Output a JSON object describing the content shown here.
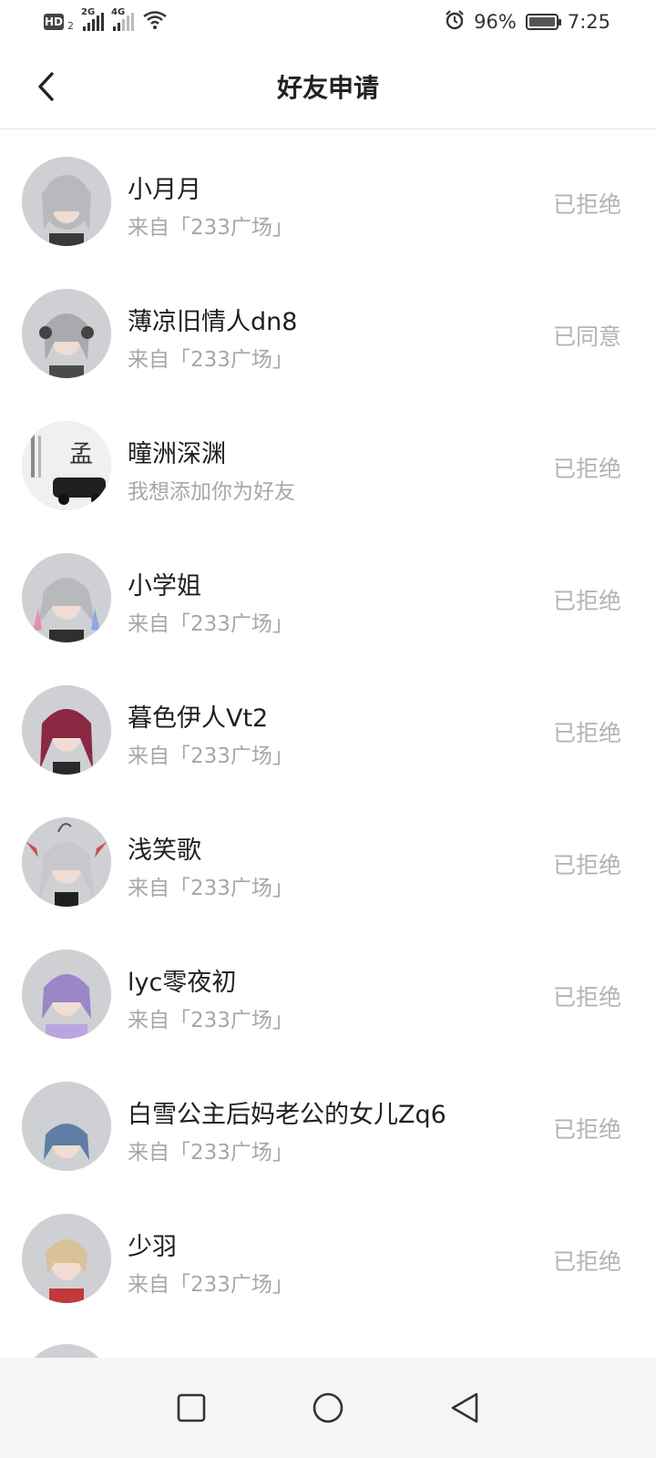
{
  "status_bar": {
    "hd_label": "HD",
    "hd_sub": "2",
    "sig1_label": "2G",
    "sig2_label": "4G",
    "battery_pct": "96%",
    "time": "7:25"
  },
  "header": {
    "title": "好友申请"
  },
  "requests": [
    {
      "name": "小月月",
      "source": "来自「233广场」",
      "status": "已拒绝"
    },
    {
      "name": "薄凉旧情人dn8",
      "source": "来自「233广场」",
      "status": "已同意"
    },
    {
      "name": "曈洲深渊",
      "source": "我想添加你为好友",
      "status": "已拒绝"
    },
    {
      "name": "小学姐",
      "source": "来自「233广场」",
      "status": "已拒绝"
    },
    {
      "name": "暮色伊人Vt2",
      "source": "来自「233广场」",
      "status": "已拒绝"
    },
    {
      "name": "浅笑歌",
      "source": "来自「233广场」",
      "status": "已拒绝"
    },
    {
      "name": "lyc零夜初",
      "source": "来自「233广场」",
      "status": "已拒绝"
    },
    {
      "name": "白雪公主后妈老公的女儿Zq6",
      "source": "来自「233广场」",
      "status": "已拒绝"
    },
    {
      "name": "少羽",
      "source": "来自「233广场」",
      "status": "已拒绝"
    }
  ],
  "colors": {
    "name_text": "#1f1f1f",
    "sub_text": "#a7a7a7",
    "status_text": "#b3b3b3",
    "avatar_bg": "#cfd0d4",
    "divider": "#e6e6e6"
  },
  "icons": {
    "back": "chevron-left-icon",
    "nav_recent": "square-icon",
    "nav_home": "circle-icon",
    "nav_back": "triangle-back-icon"
  }
}
